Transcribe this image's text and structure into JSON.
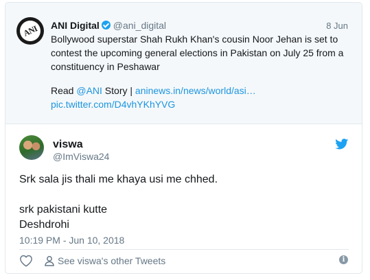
{
  "quoted_tweet": {
    "author_name": "ANI Digital",
    "verified": true,
    "handle": "@ani_digital",
    "date": "8 Jun",
    "avatar_text": "ANI",
    "text": "Bollywood superstar Shah Rukh Khan's cousin Noor Jehan is set to contest the upcoming general elections in Pakistan on July 25 from a constituency in Peshawar",
    "read_prefix": "Read ",
    "read_mention": "@ANI",
    "read_middle": " Story | ",
    "read_link": "aninews.in/news/world/asi…",
    "pic_link": "pic.twitter.com/D4vhYKhYVG"
  },
  "tweet": {
    "author_name": "viswa",
    "handle": "@ImViswa24",
    "lines": [
      "Srk sala jis thali me khaya usi me chhed.",
      "srk pakistani kutte",
      "Deshdrohi"
    ],
    "timestamp": "10:19 PM - Jun 10, 2018"
  },
  "actions": {
    "like_icon": "heart-icon",
    "profile_icon": "person-icon",
    "profile_link": "See viswa's other Tweets",
    "info_icon": "info-icon",
    "info_glyph": "i"
  },
  "colors": {
    "link": "#1b95e0",
    "twitter_blue": "#1da1f2",
    "secondary_text": "#657786"
  }
}
